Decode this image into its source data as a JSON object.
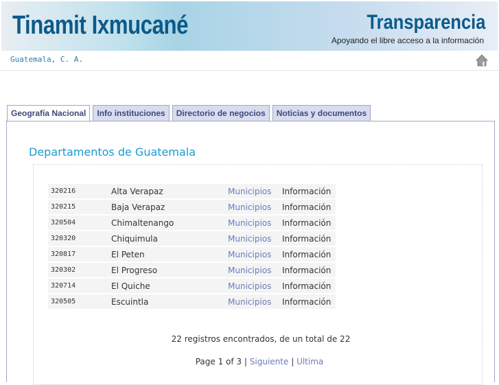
{
  "header": {
    "title": "Tinamit Ixmucané",
    "brand": "Transparencia",
    "tagline": "Apoyando el libre acceso a la información",
    "location": "Guatemala, C. A."
  },
  "tabs": [
    {
      "label": "Geografía Nacional"
    },
    {
      "label": "Info instituciones"
    },
    {
      "label": "Directorio de negocios"
    },
    {
      "label": "Noticias y documentos"
    }
  ],
  "main": {
    "heading": "Departamentos de Guatemala",
    "rows": [
      {
        "code": "320216",
        "name": "Alta Verapaz",
        "link": "Municipios",
        "info": "Información"
      },
      {
        "code": "320215",
        "name": "Baja Verapaz",
        "link": "Municipios",
        "info": "Información"
      },
      {
        "code": "320504",
        "name": "Chimaltenango",
        "link": "Municipios",
        "info": "Información"
      },
      {
        "code": "320320",
        "name": "Chiquimula",
        "link": "Municipios",
        "info": "Información"
      },
      {
        "code": "320817",
        "name": "El Peten",
        "link": "Municipios",
        "info": "Información"
      },
      {
        "code": "320302",
        "name": "El Progreso",
        "link": "Municipios",
        "info": "Información"
      },
      {
        "code": "320714",
        "name": "El Quiche",
        "link": "Municipios",
        "info": "Información"
      },
      {
        "code": "320505",
        "name": "Escuintla",
        "link": "Municipios",
        "info": "Información"
      }
    ],
    "count": "22 registros encontrados, de un total de 22",
    "pager": {
      "page": "Page 1 of 3",
      "sep": "|",
      "next": "Siguiente",
      "last": "Ultima"
    }
  }
}
